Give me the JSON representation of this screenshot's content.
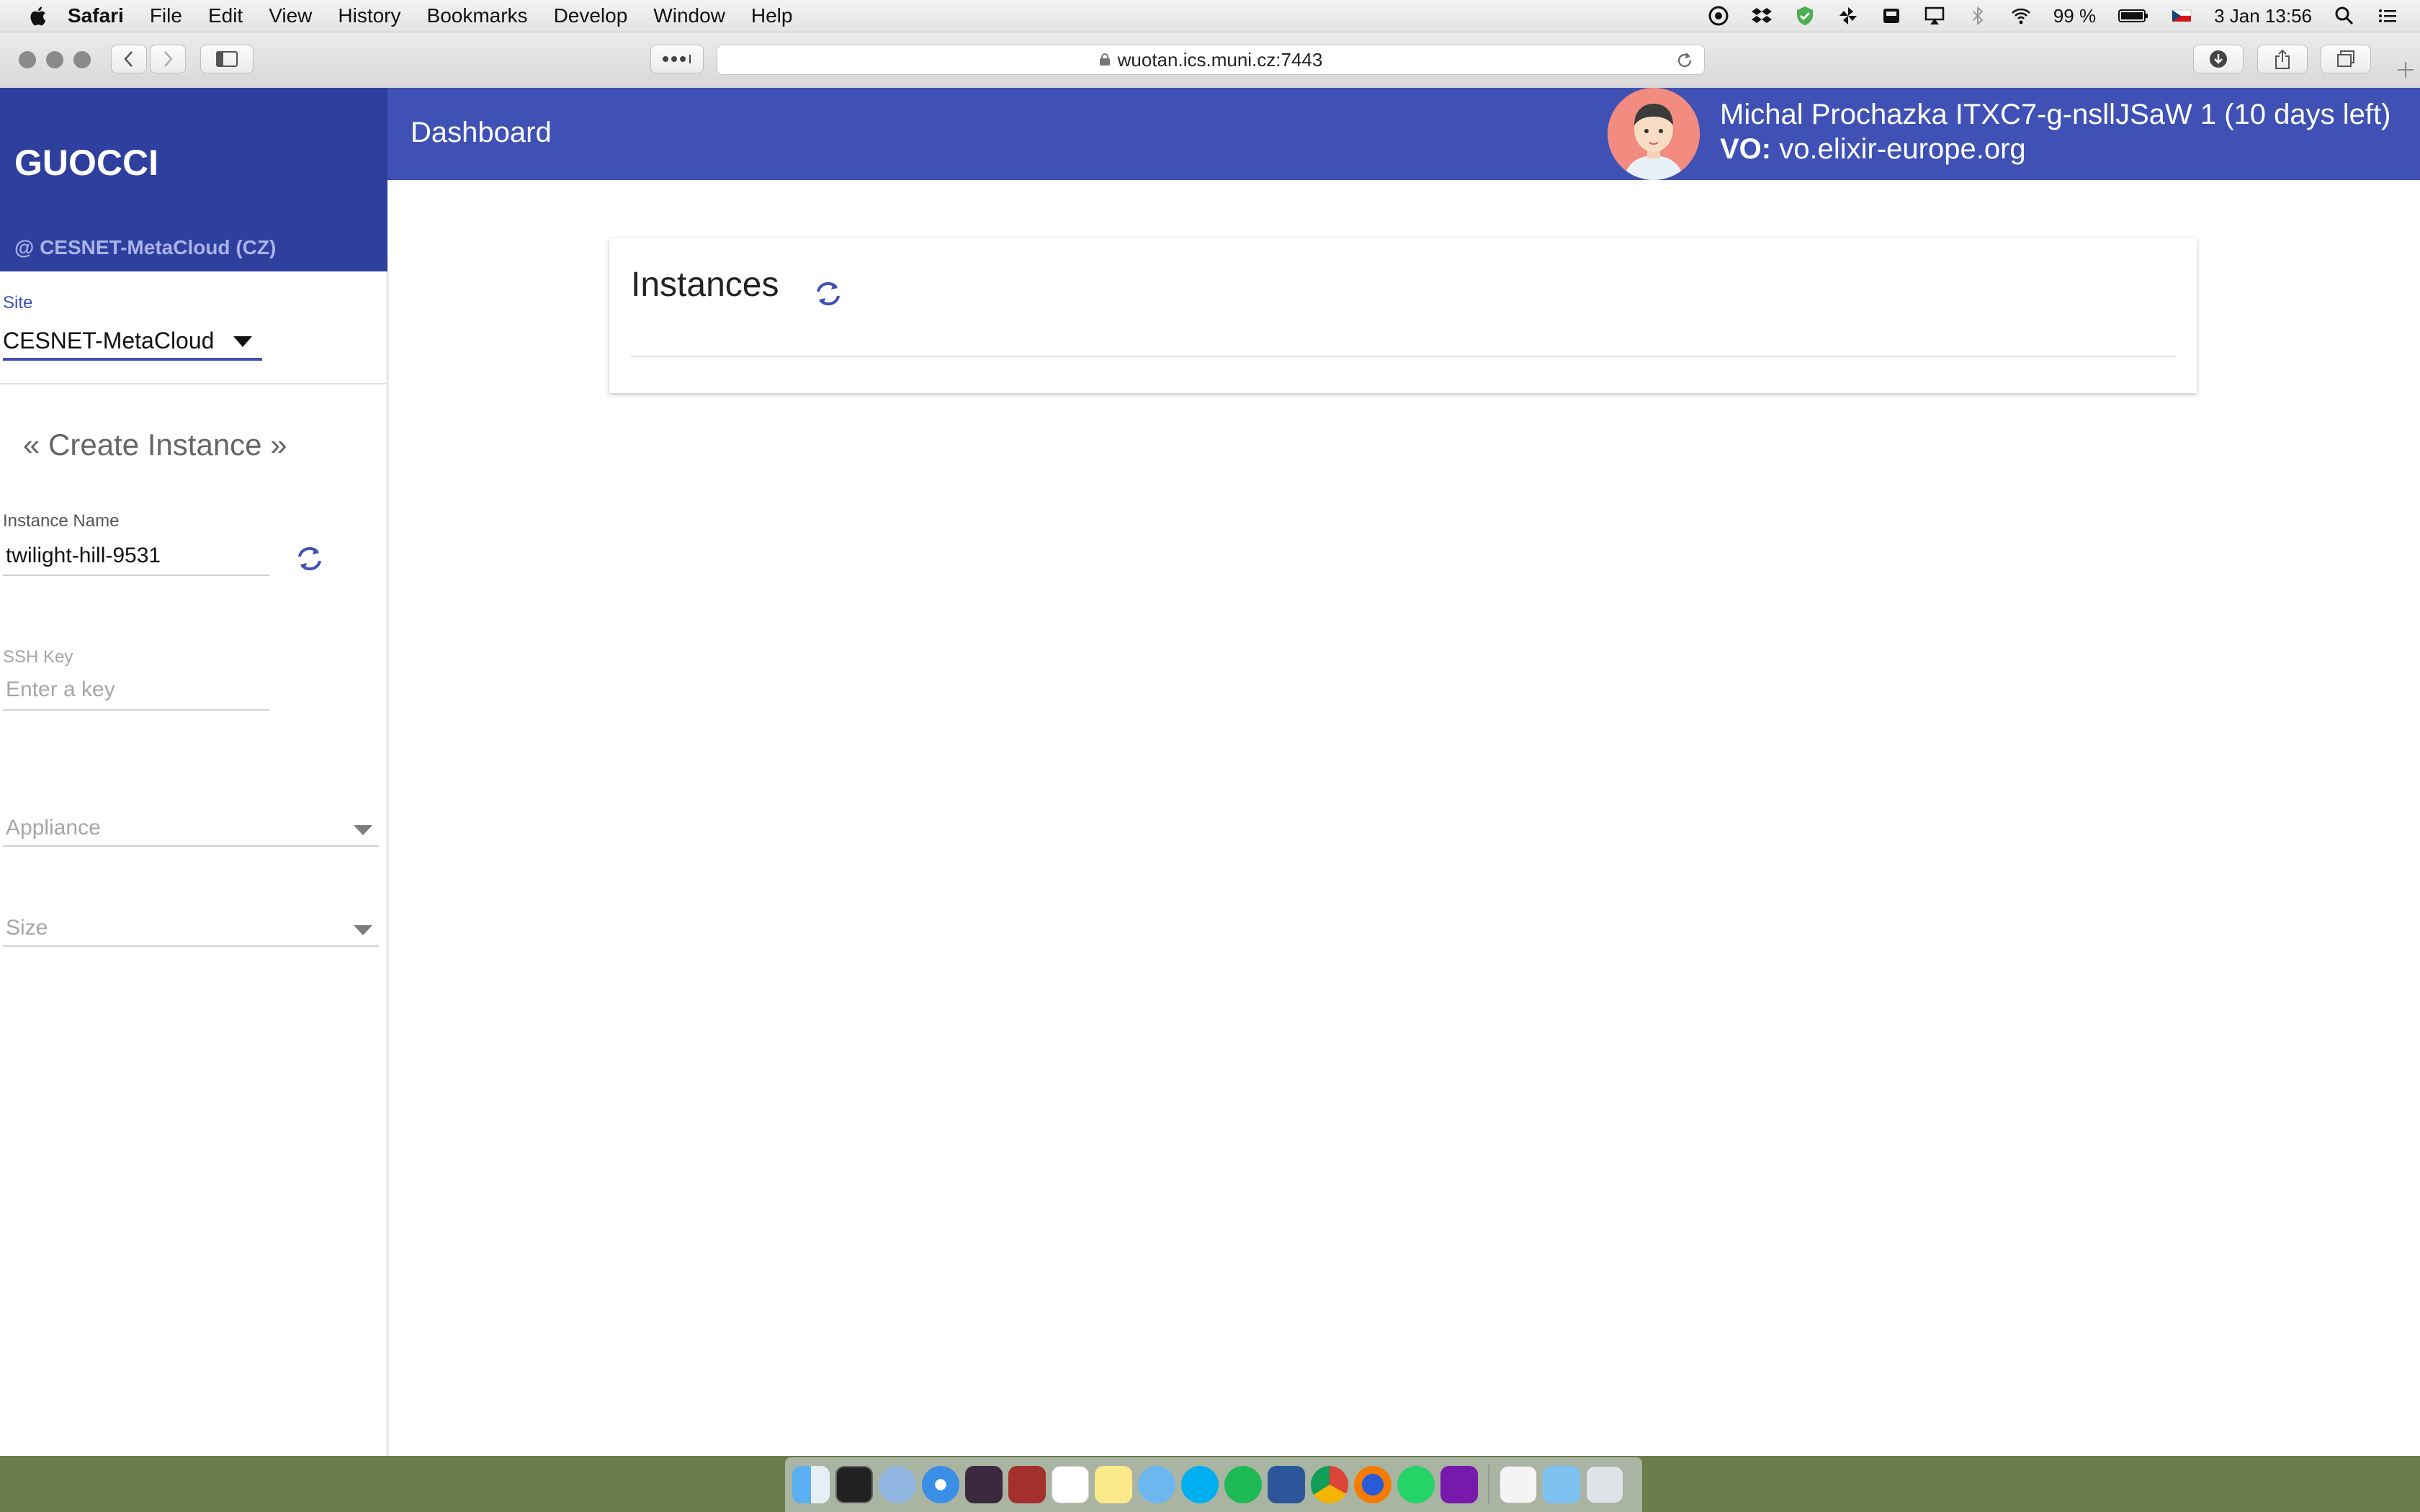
{
  "menubar": {
    "app": "Safari",
    "items": [
      "File",
      "Edit",
      "View",
      "History",
      "Bookmarks",
      "Develop",
      "Window",
      "Help"
    ],
    "battery": "99 %",
    "datetime": "3 Jan  13:56"
  },
  "browser": {
    "url": "wuotan.ics.muni.cz:7443"
  },
  "app": {
    "brand": "GUOCCI",
    "site_subtitle": "@ CESNET-MetaCloud (CZ)",
    "page_title": "Dashboard",
    "user_line": "Michal Prochazka ITXC7-g-nsllJSaW 1 (10 days left)",
    "vo_label": "VO:",
    "vo_value": "vo.elixir-europe.org"
  },
  "sidebar": {
    "site_label": "Site",
    "site_value": "CESNET-MetaCloud",
    "create_title": "« Create Instance »",
    "instance_name_label": "Instance Name",
    "instance_name_value": "twilight-hill-9531",
    "ssh_key_label": "SSH Key",
    "ssh_key_placeholder": "Enter a key",
    "appliance_placeholder": "Appliance",
    "size_placeholder": "Size"
  },
  "main": {
    "instances_title": "Instances"
  },
  "colors": {
    "primary": "#3f51b5",
    "sidebar_header": "#2f3f9e"
  },
  "dock_icons": [
    "finder-icon",
    "terminal-icon",
    "mail-icon",
    "safari-icon",
    "slack-icon",
    "dictionary-icon",
    "calendar-icon",
    "notes-icon",
    "messages-icon",
    "skype-icon",
    "spotify-icon",
    "word-icon",
    "chrome-icon",
    "firefox-icon",
    "whatsapp-icon",
    "onenote-icon",
    "document-icon",
    "folder-icon",
    "trash-icon"
  ]
}
